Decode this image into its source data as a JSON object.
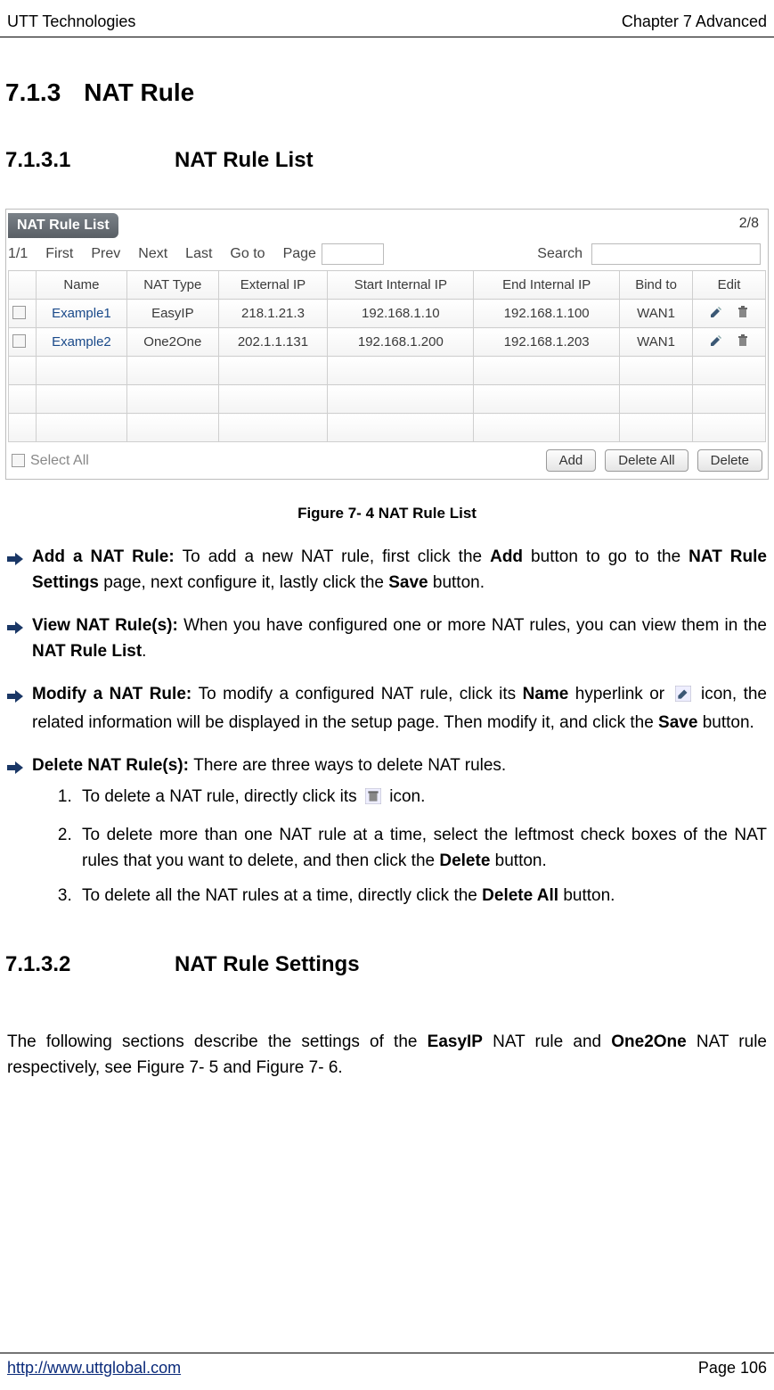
{
  "header": {
    "left": "UTT Technologies",
    "right": "Chapter 7 Advanced"
  },
  "section": {
    "num": "7.1.3",
    "title": "NAT Rule"
  },
  "sub1": {
    "num": "7.1.3.1",
    "title": "NAT Rule List"
  },
  "screenshot": {
    "panel_title": "NAT Rule List",
    "count": "2/8",
    "pager": {
      "pos": "1/1",
      "first": "First",
      "prev": "Prev",
      "next": "Next",
      "last": "Last",
      "goto": "Go to",
      "page": "Page",
      "search": "Search"
    },
    "cols": {
      "name": "Name",
      "nat_type": "NAT Type",
      "ext_ip": "External IP",
      "start": "Start Internal IP",
      "end": "End Internal IP",
      "bind": "Bind to",
      "edit": "Edit"
    },
    "rows": [
      {
        "name": "Example1",
        "type": "EasyIP",
        "ext": "218.1.21.3",
        "start": "192.168.1.10",
        "end": "192.168.1.100",
        "bind": "WAN1"
      },
      {
        "name": "Example2",
        "type": "One2One",
        "ext": "202.1.1.131",
        "start": "192.168.1.200",
        "end": "192.168.1.203",
        "bind": "WAN1"
      }
    ],
    "select_all": "Select All",
    "buttons": {
      "add": "Add",
      "delete_all": "Delete All",
      "delete": "Delete"
    }
  },
  "figcap": "Figure 7- 4 NAT Rule List",
  "bullets": {
    "add": {
      "lead": "Add a NAT Rule: ",
      "t1": "To add a new NAT rule, first click the ",
      "b1": "Add",
      "t2": " button to go to the ",
      "b2": "NAT Rule Settings",
      "t3": " page, next configure it, lastly click the ",
      "b3": "Save",
      "t4": " button."
    },
    "view": {
      "lead": "View NAT Rule(s): ",
      "t1": "When you have configured one or more NAT rules, you can view them in the ",
      "b1": "NAT Rule List",
      "t2": "."
    },
    "mod": {
      "lead": "Modify a NAT Rule: ",
      "t1": "To modify a configured NAT rule, click its ",
      "b1": "Name",
      "t2": " hyperlink or ",
      "t3": " icon, the related information will be displayed in the setup page. Then modify it, and click the ",
      "b2": "Save",
      "t4": " button."
    },
    "del": {
      "lead": "Delete NAT Rule(s): ",
      "t1": "There are three ways to delete NAT rules.",
      "n1a": "To delete a NAT rule, directly click its ",
      "n1b": " icon.",
      "n2a": "To delete more than one NAT rule at a time, select the leftmost check boxes of the NAT rules that you want to delete, and then click the ",
      "n2b": "Delete",
      "n2c": " button.",
      "n3a": "To delete all the NAT rules at a time, directly click the ",
      "n3b": "Delete All",
      "n3c": " button."
    }
  },
  "sub2": {
    "num": "7.1.3.2",
    "title": "NAT Rule Settings"
  },
  "para": {
    "t1": "The following sections describe the settings of the ",
    "b1": "EasyIP",
    "t2": " NAT rule and ",
    "b2": "One2One",
    "t3": " NAT rule respectively, see Figure 7- 5 and Figure 7- 6."
  },
  "footer": {
    "url": "http://www.uttglobal.com",
    "page": "Page 106"
  }
}
